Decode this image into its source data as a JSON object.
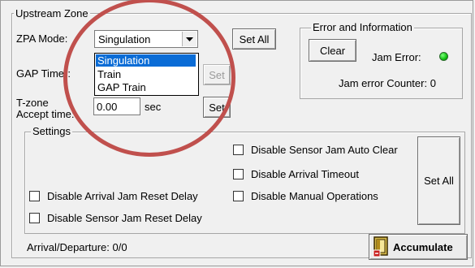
{
  "upstream_zone": {
    "title": "Upstream Zone",
    "zpa_mode_label": "ZPA Mode:",
    "zpa_mode_value": "Singulation",
    "zpa_mode_options": [
      "Singulation",
      "Train",
      "GAP Train"
    ],
    "set_all_label": "Set All",
    "gap_timer_label": "GAP Timer:",
    "gap_set_label": "Set",
    "tzone_label_line1": "T-zone",
    "tzone_label_line2": "Accept time:",
    "tzone_value": "0.00",
    "tzone_unit": "sec",
    "tzone_set_label": "Set"
  },
  "error_info": {
    "title": "Error and Information",
    "clear_label": "Clear",
    "jam_error_label": "Jam Error:",
    "jam_error_color": "#10c010",
    "jam_counter_text": "Jam error Counter: 0"
  },
  "settings": {
    "title": "Settings",
    "checks": {
      "sensor_jam_auto_clear": "Disable Sensor Jam Auto Clear",
      "arrival_timeout": "Disable Arrival Timeout",
      "arrival_jam_reset_delay": "Disable Arrival Jam Reset Delay",
      "manual_operations": "Disable Manual Operations",
      "sensor_jam_reset_delay": "Disable Sensor Jam Reset Delay"
    },
    "set_all_label": "Set All"
  },
  "status": {
    "arrival_departure": "Arrival/Departure: 0/0",
    "accumulate_label": "Accumulate"
  },
  "annotation": {
    "color": "#c0504d"
  }
}
